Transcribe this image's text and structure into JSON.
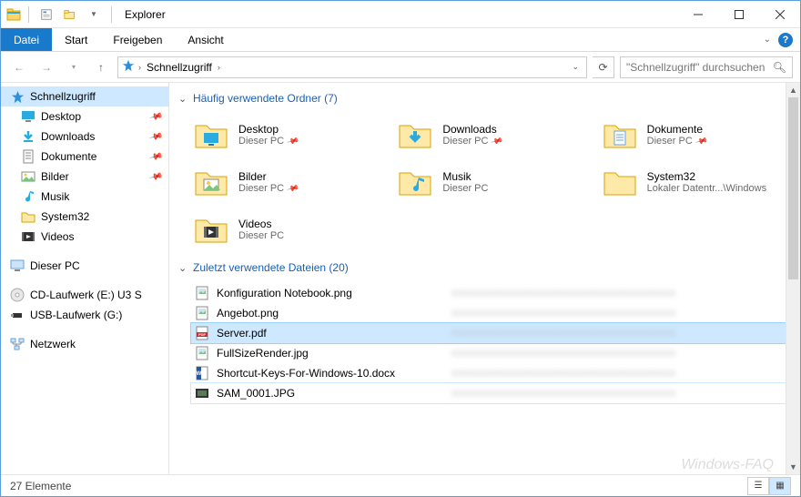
{
  "window": {
    "title": "Explorer"
  },
  "ribbon": {
    "tabs": [
      "Datei",
      "Start",
      "Freigeben",
      "Ansicht"
    ],
    "active": 0
  },
  "address": {
    "segments": [
      "Schnellzugriff"
    ]
  },
  "search": {
    "placeholder": "\"Schnellzugriff\" durchsuchen"
  },
  "sidebar": {
    "quick": {
      "label": "Schnellzugriff",
      "selected": true
    },
    "quick_items": [
      {
        "label": "Desktop",
        "icon": "desktop",
        "pinned": true
      },
      {
        "label": "Downloads",
        "icon": "downloads",
        "pinned": true
      },
      {
        "label": "Dokumente",
        "icon": "documents",
        "pinned": true
      },
      {
        "label": "Bilder",
        "icon": "pictures",
        "pinned": true
      },
      {
        "label": "Musik",
        "icon": "music",
        "pinned": false
      },
      {
        "label": "System32",
        "icon": "folder",
        "pinned": false
      },
      {
        "label": "Videos",
        "icon": "videos",
        "pinned": false
      }
    ],
    "thispc": {
      "label": "Dieser PC"
    },
    "drives": [
      {
        "label": "CD-Laufwerk (E:) U3 S",
        "icon": "cd"
      },
      {
        "label": "USB-Laufwerk (G:)",
        "icon": "usb"
      }
    ],
    "network": {
      "label": "Netzwerk"
    }
  },
  "sections": {
    "frequent": {
      "title": "Häufig verwendete Ordner (7)"
    },
    "recent": {
      "title": "Zuletzt verwendete Dateien (20)"
    }
  },
  "tiles": [
    {
      "name": "Desktop",
      "sub": "Dieser PC",
      "icon": "desktop",
      "pinned": true
    },
    {
      "name": "Downloads",
      "sub": "Dieser PC",
      "icon": "downloads",
      "pinned": true
    },
    {
      "name": "Dokumente",
      "sub": "Dieser PC",
      "icon": "documents",
      "pinned": true
    },
    {
      "name": "Bilder",
      "sub": "Dieser PC",
      "icon": "pictures",
      "pinned": true
    },
    {
      "name": "Musik",
      "sub": "Dieser PC",
      "icon": "music",
      "pinned": false
    },
    {
      "name": "System32",
      "sub": "Lokaler Datentr...\\Windows",
      "icon": "folder",
      "pinned": false
    },
    {
      "name": "Videos",
      "sub": "Dieser PC",
      "icon": "videos",
      "pinned": false
    }
  ],
  "files": [
    {
      "name": "Konfiguration Notebook.png",
      "icon": "png",
      "sel": false
    },
    {
      "name": "Angebot.png",
      "icon": "png",
      "sel": false
    },
    {
      "name": "Server.pdf",
      "icon": "pdf",
      "sel": true
    },
    {
      "name": "FullSizeRender.jpg",
      "icon": "jpg",
      "sel": false
    },
    {
      "name": "Shortcut-Keys-For-Windows-10.docx",
      "icon": "docx",
      "sel": false
    },
    {
      "name": "SAM_0001.JPG",
      "icon": "jpg2",
      "sel": false,
      "hov": true
    }
  ],
  "status": {
    "text": "27 Elemente"
  },
  "watermark": "Windows-FAQ"
}
